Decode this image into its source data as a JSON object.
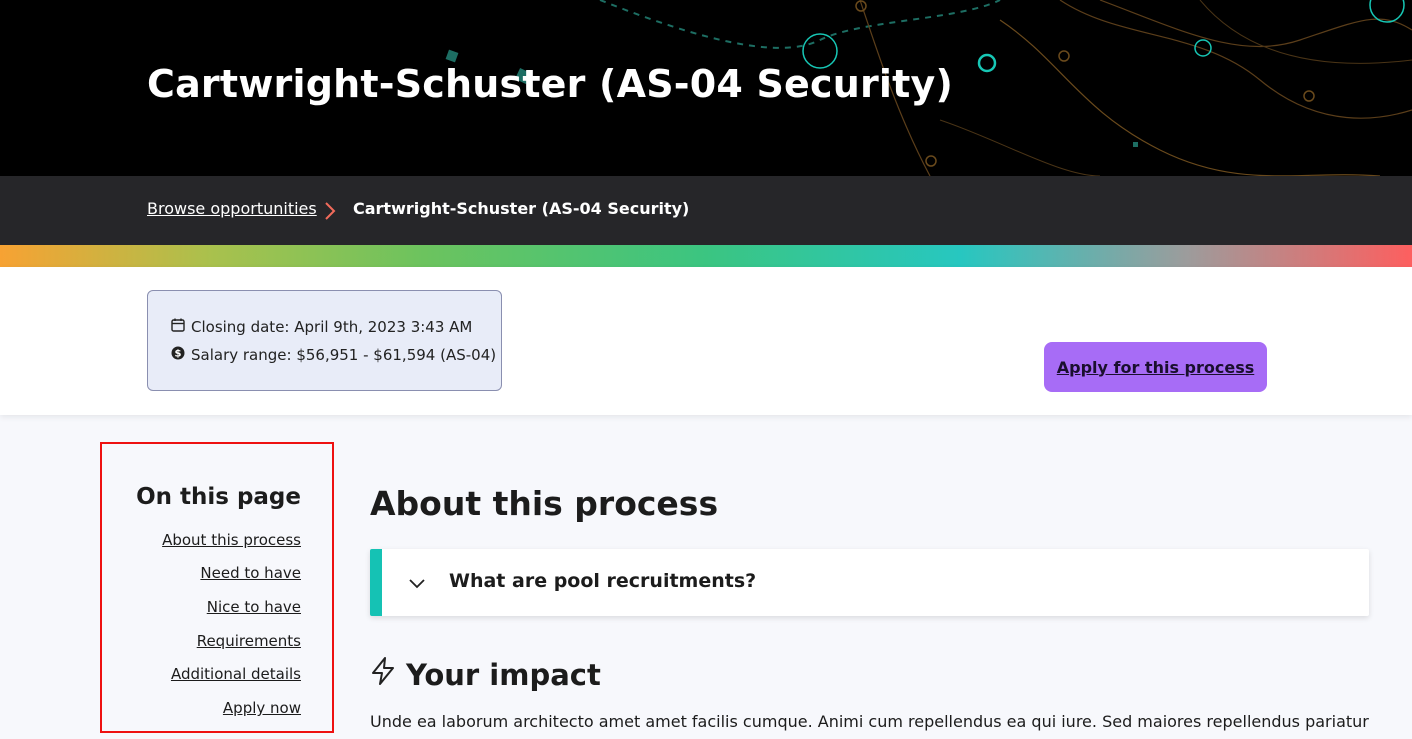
{
  "hero": {
    "title": "Cartwright-Schuster (AS-04 Security)"
  },
  "breadcrumb": {
    "items": [
      {
        "label": "Browse opportunities"
      },
      {
        "label": "Cartwright-Schuster (AS-04 Security)"
      }
    ]
  },
  "info": {
    "closing_date": "Closing date: April 9th, 2023 3:43 AM",
    "salary_range": "Salary range: $56,951 - $61,594 (AS-04)"
  },
  "apply_button": {
    "label": "Apply for this process"
  },
  "toc": {
    "title": "On this page",
    "links": [
      {
        "label": "About this process"
      },
      {
        "label": "Need to have"
      },
      {
        "label": "Nice to have"
      },
      {
        "label": "Requirements"
      },
      {
        "label": "Additional details"
      },
      {
        "label": "Apply now"
      }
    ]
  },
  "main": {
    "about_heading": "About this process",
    "accordion_label": "What are pool recruitments?",
    "impact_heading": "Your impact",
    "impact_text": "Unde ea laborum architecto amet amet facilis cumque. Animi cum repellendus ea qui iure. Sed maiores repellendus pariatur"
  },
  "colors": {
    "accent_purple": "#a76cf6",
    "accordion_teal": "#15c2b4",
    "highlight_red": "#ee1111"
  },
  "icons": [
    "calendar-icon",
    "dollar-icon",
    "chevron-right-icon",
    "chevron-down-icon",
    "lightning-icon"
  ]
}
